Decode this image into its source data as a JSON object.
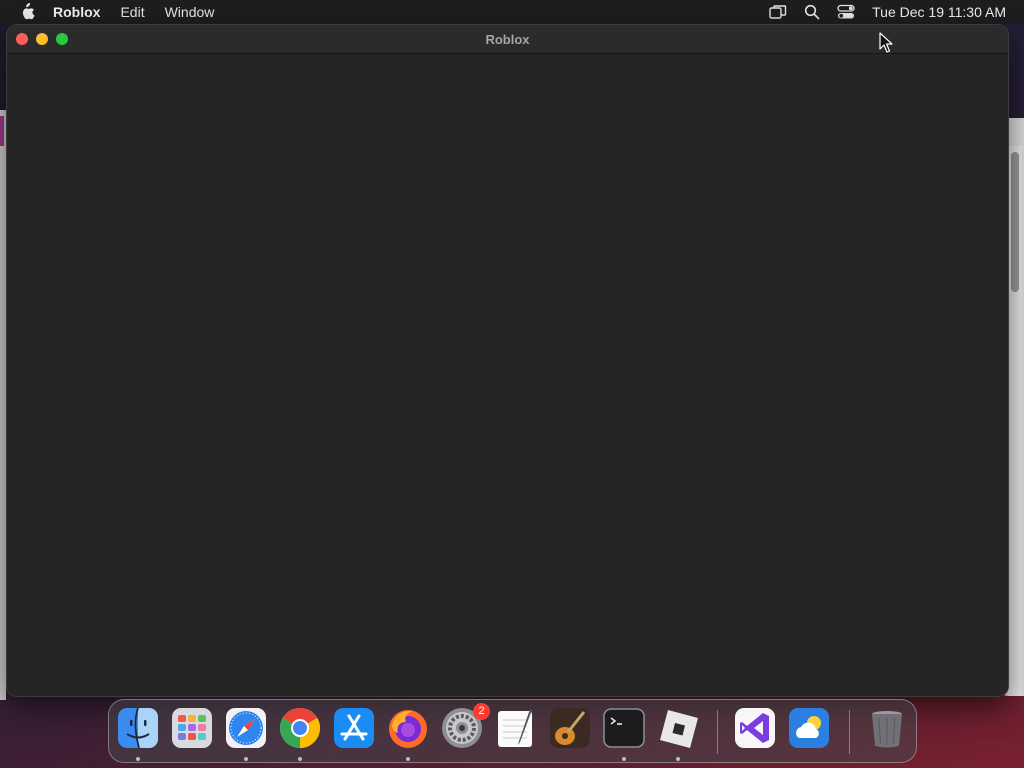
{
  "menubar": {
    "app_name": "Roblox",
    "menus": [
      "Edit",
      "Window"
    ],
    "clock": "Tue Dec 19  11:30 AM",
    "status_icons": [
      "screen-mirroring-icon",
      "spotlight-search-icon",
      "control-center-icon"
    ]
  },
  "window": {
    "title": "Roblox",
    "content_color": "#252525"
  },
  "dock": {
    "items": [
      {
        "icon": "finder-icon",
        "running": true
      },
      {
        "icon": "launchpad-icon",
        "running": false
      },
      {
        "icon": "safari-icon",
        "running": true
      },
      {
        "icon": "chrome-icon",
        "running": true
      },
      {
        "icon": "app-store-icon",
        "running": false
      },
      {
        "icon": "firefox-icon",
        "running": true
      },
      {
        "icon": "system-settings-icon",
        "running": false,
        "badge": "2"
      },
      {
        "icon": "textedit-icon",
        "running": false
      },
      {
        "icon": "garageband-icon",
        "running": false
      },
      {
        "icon": "terminal-icon",
        "running": true
      },
      {
        "icon": "roblox-icon",
        "running": true
      },
      {
        "icon": "visual-studio-icon",
        "running": false
      },
      {
        "icon": "weather-icon",
        "running": false
      },
      {
        "icon": "trash-icon",
        "running": false
      }
    ]
  },
  "colors": {
    "close": "#ff5f57",
    "minimize": "#febc2e",
    "maximize": "#28c840",
    "badge": "#ff3b30"
  }
}
